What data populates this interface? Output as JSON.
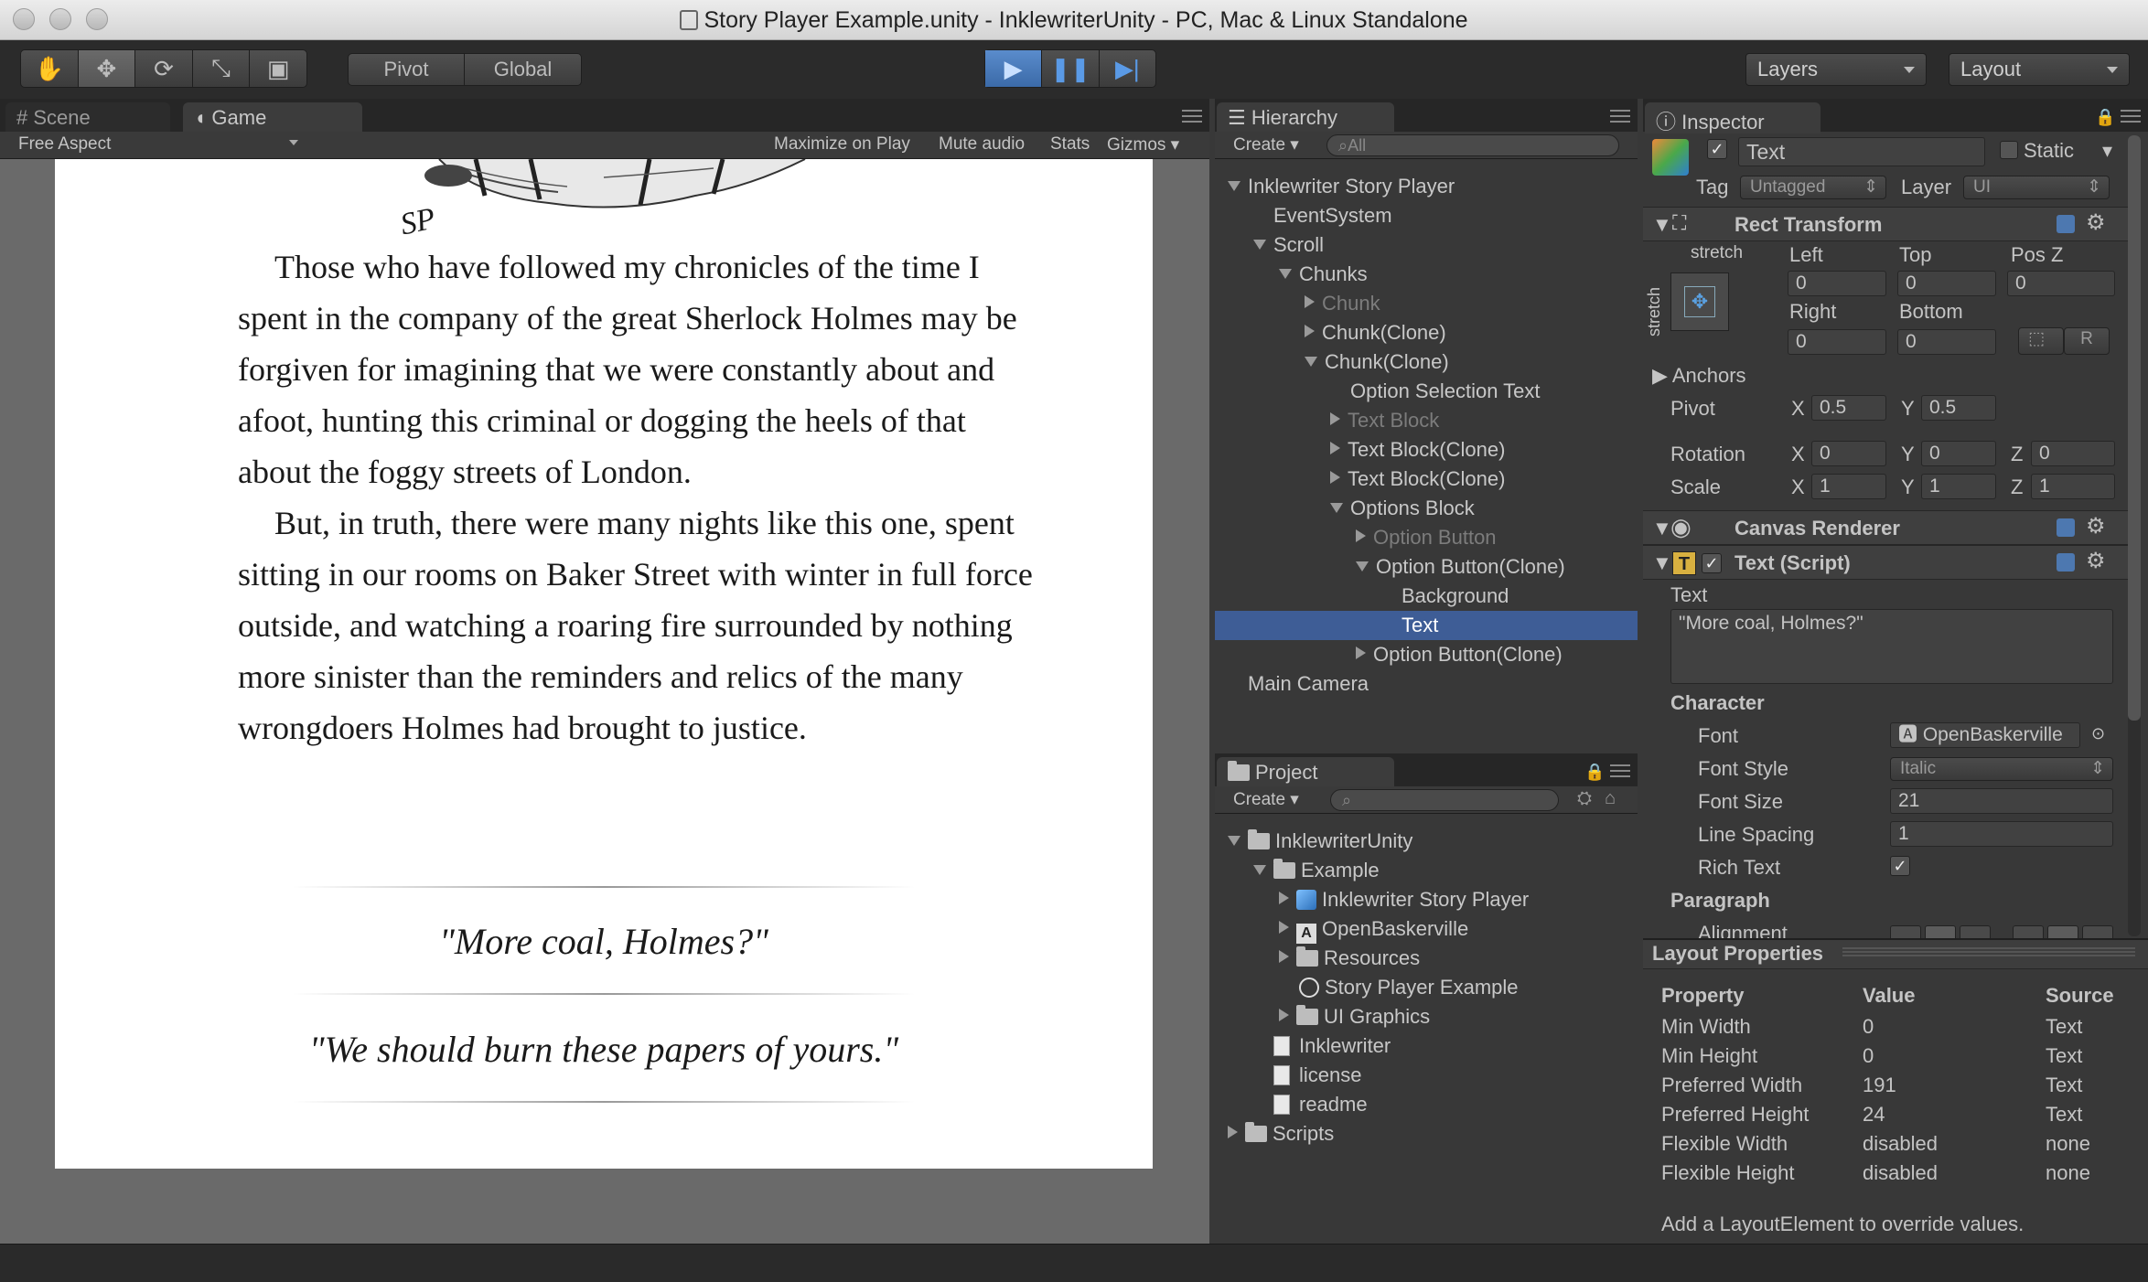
{
  "window": {
    "title": "Story Player Example.unity - InklewriterUnity - PC, Mac & Linux Standalone"
  },
  "toolbar": {
    "pivot_label": "Pivot",
    "global_label": "Global",
    "layers_label": "Layers",
    "layout_label": "Layout"
  },
  "game_panel": {
    "tabs": [
      {
        "label": "Scene",
        "active": false
      },
      {
        "label": "Game",
        "active": true
      }
    ],
    "aspect_label": "Free Aspect",
    "options": [
      "Maximize on Play",
      "Mute audio",
      "Stats",
      "Gizmos"
    ],
    "illustration_signature": "SP",
    "paragraphs": [
      "Those who have followed my chronicles of the time I spent in the company of the great Sherlock Holmes may be forgiven for imagining that we were constantly about and afoot, hunting this criminal or dogging the heels of that about the foggy streets of London.",
      "But, in truth, there were many nights like this one, spent sitting in our rooms on Baker Street with winter in full force outside, and watching a roaring fire surrounded by nothing more sinister than the reminders and relics of the many wrongdoers Holmes had brought to justice."
    ],
    "choices": [
      "\"More coal, Holmes?\"",
      "\"We should burn these papers of yours.\""
    ]
  },
  "hierarchy": {
    "tab_label": "Hierarchy",
    "create_label": "Create",
    "search_placeholder": "All",
    "items": [
      {
        "label": "Inklewriter Story Player",
        "depth": 0,
        "arrow": "open",
        "dim": false,
        "selected": false
      },
      {
        "label": "EventSystem",
        "depth": 1,
        "arrow": "none",
        "dim": false,
        "selected": false
      },
      {
        "label": "Scroll",
        "depth": 1,
        "arrow": "open",
        "dim": false,
        "selected": false
      },
      {
        "label": "Chunks",
        "depth": 2,
        "arrow": "open",
        "dim": false,
        "selected": false
      },
      {
        "label": "Chunk",
        "depth": 3,
        "arrow": "closed",
        "dim": true,
        "selected": false
      },
      {
        "label": "Chunk(Clone)",
        "depth": 3,
        "arrow": "closed",
        "dim": false,
        "selected": false
      },
      {
        "label": "Chunk(Clone)",
        "depth": 3,
        "arrow": "open",
        "dim": false,
        "selected": false
      },
      {
        "label": "Option Selection Text",
        "depth": 4,
        "arrow": "none",
        "dim": false,
        "selected": false
      },
      {
        "label": "Text Block",
        "depth": 4,
        "arrow": "closed",
        "dim": true,
        "selected": false
      },
      {
        "label": "Text Block(Clone)",
        "depth": 4,
        "arrow": "closed",
        "dim": false,
        "selected": false
      },
      {
        "label": "Text Block(Clone)",
        "depth": 4,
        "arrow": "closed",
        "dim": false,
        "selected": false
      },
      {
        "label": "Options Block",
        "depth": 4,
        "arrow": "open",
        "dim": false,
        "selected": false
      },
      {
        "label": "Option Button",
        "depth": 5,
        "arrow": "closed",
        "dim": true,
        "selected": false
      },
      {
        "label": "Option Button(Clone)",
        "depth": 5,
        "arrow": "open",
        "dim": false,
        "selected": false
      },
      {
        "label": "Background",
        "depth": 6,
        "arrow": "none",
        "dim": false,
        "selected": false
      },
      {
        "label": "Text",
        "depth": 6,
        "arrow": "none",
        "dim": false,
        "selected": true
      },
      {
        "label": "Option Button(Clone)",
        "depth": 5,
        "arrow": "closed",
        "dim": false,
        "selected": false
      },
      {
        "label": "Main Camera",
        "depth": 0,
        "arrow": "none",
        "dim": false,
        "selected": false
      }
    ]
  },
  "project": {
    "tab_label": "Project",
    "create_label": "Create",
    "items": [
      {
        "label": "InklewriterUnity",
        "depth": 0,
        "arrow": "open",
        "icon": "folder-icon"
      },
      {
        "label": "Example",
        "depth": 1,
        "arrow": "open",
        "icon": "folder-icon"
      },
      {
        "label": "Inklewriter Story Player",
        "depth": 2,
        "arrow": "closed",
        "icon": "prefab-icon"
      },
      {
        "label": "OpenBaskerville",
        "depth": 2,
        "arrow": "closed",
        "icon": "font-icon"
      },
      {
        "label": "Resources",
        "depth": 2,
        "arrow": "closed",
        "icon": "folder-icon"
      },
      {
        "label": "Story Player Example",
        "depth": 2,
        "arrow": "none",
        "icon": "scene-icon"
      },
      {
        "label": "UI Graphics",
        "depth": 2,
        "arrow": "closed",
        "icon": "folder-icon"
      },
      {
        "label": "Inklewriter",
        "depth": 1,
        "arrow": "none",
        "icon": "file-icon"
      },
      {
        "label": "license",
        "depth": 1,
        "arrow": "none",
        "icon": "file-icon"
      },
      {
        "label": "readme",
        "depth": 1,
        "arrow": "none",
        "icon": "file-icon"
      },
      {
        "label": "Scripts",
        "depth": 0,
        "arrow": "closed",
        "icon": "folder-icon"
      }
    ]
  },
  "inspector": {
    "tab_label": "Inspector",
    "object_name": "Text",
    "static_label": "Static",
    "tag_label": "Tag",
    "tag_value": "Untagged",
    "layer_label": "Layer",
    "layer_value": "UI",
    "rect_transform": {
      "title": "Rect Transform",
      "stretch_top": "stretch",
      "stretch_side": "stretch",
      "left_label": "Left",
      "top_label": "Top",
      "posz_label": "Pos Z",
      "left": "0",
      "top": "0",
      "posz": "0",
      "right_label": "Right",
      "bottom_label": "Bottom",
      "right": "0",
      "bottom": "0",
      "r_button": "R",
      "anchors_label": "Anchors",
      "pivot_label": "Pivot",
      "pivot_x": "0.5",
      "pivot_y": "0.5",
      "rotation_label": "Rotation",
      "rot_x": "0",
      "rot_y": "0",
      "rot_z": "0",
      "scale_label": "Scale",
      "scale_x": "1",
      "scale_y": "1",
      "scale_z": "1",
      "x": "X",
      "y": "Y",
      "z": "Z"
    },
    "canvas_renderer": {
      "title": "Canvas Renderer"
    },
    "text_script": {
      "title": "Text (Script)",
      "text_label": "Text",
      "text_value": "\"More coal, Holmes?\"",
      "character_label": "Character",
      "font_label": "Font",
      "font_value": "OpenBaskerville",
      "font_style_label": "Font Style",
      "font_style_value": "Italic",
      "font_size_label": "Font Size",
      "font_size_value": "21",
      "line_spacing_label": "Line Spacing",
      "line_spacing_value": "1",
      "rich_text_label": "Rich Text",
      "rich_text_checked": true,
      "paragraph_label": "Paragraph",
      "alignment_label": "Alignment"
    }
  },
  "layout_properties": {
    "title": "Layout Properties",
    "headers": [
      "Property",
      "Value",
      "Source"
    ],
    "rows": [
      [
        "Min Width",
        "0",
        "Text"
      ],
      [
        "Min Height",
        "0",
        "Text"
      ],
      [
        "Preferred Width",
        "191",
        "Text"
      ],
      [
        "Preferred Height",
        "24",
        "Text"
      ],
      [
        "Flexible Width",
        "disabled",
        "none"
      ],
      [
        "Flexible Height",
        "disabled",
        "none"
      ]
    ],
    "footer": "Add a LayoutElement to override values."
  },
  "colors": {
    "selection": "#3e5d96",
    "play_blue": "#3d7fd6"
  }
}
